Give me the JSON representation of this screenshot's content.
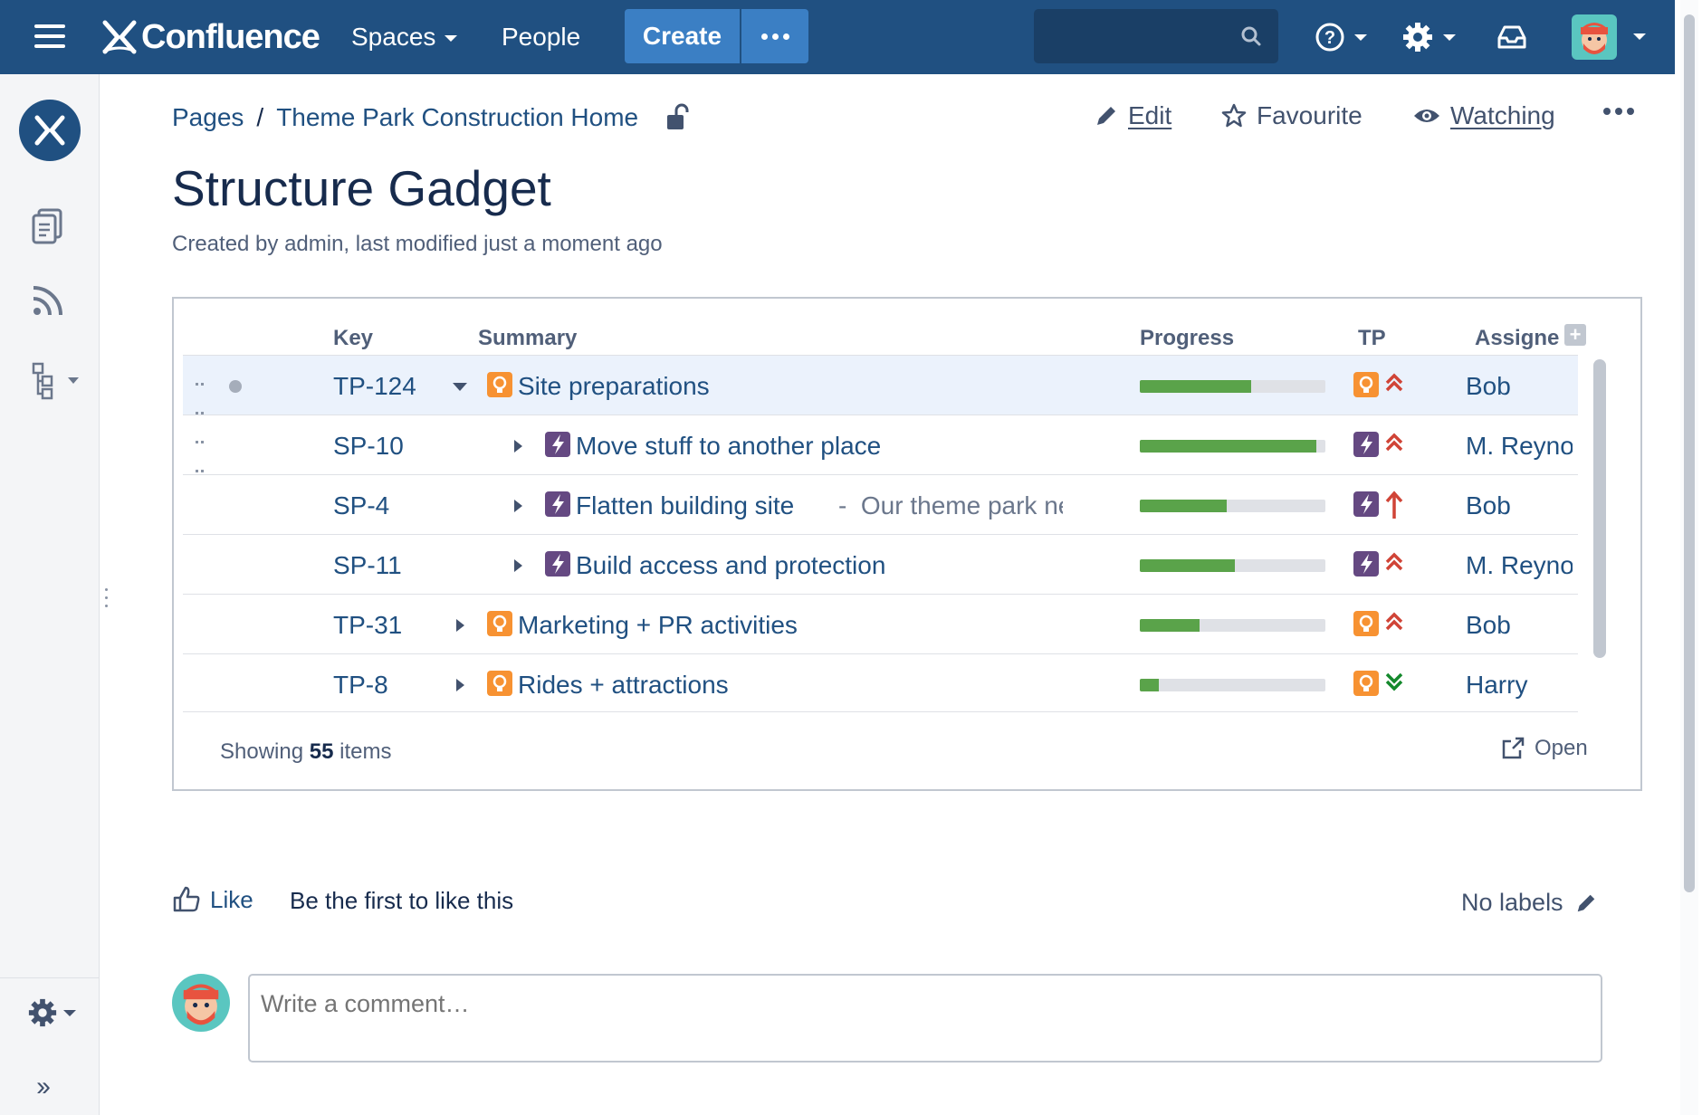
{
  "nav": {
    "brand": "Confluence",
    "spaces": "Spaces",
    "people": "People",
    "create": "Create",
    "search_placeholder": ""
  },
  "breadcrumb": {
    "pages": "Pages",
    "separator": "/",
    "home": "Theme Park Construction Home"
  },
  "actions": {
    "edit": "Edit",
    "favourite": "Favourite",
    "watching": "Watching"
  },
  "page": {
    "title": "Structure Gadget",
    "byline": "Created by admin, last modified just a moment ago"
  },
  "grid": {
    "columns": {
      "key": "Key",
      "summary": "Summary",
      "progress": "Progress",
      "tp": "TP",
      "assignee": "Assigne"
    },
    "rows": [
      {
        "key": "TP-124",
        "summary": "Site preparations",
        "desc": "",
        "progress": 0.6,
        "assignee": "Bob",
        "type": "idea",
        "priority": "high",
        "expanded": true,
        "level": 0
      },
      {
        "key": "SP-10",
        "summary": "Move stuff to another place",
        "desc": "",
        "progress": 0.95,
        "assignee": "M. Reynolds",
        "type": "epic",
        "priority": "high",
        "expanded": false,
        "level": 1
      },
      {
        "key": "SP-4",
        "summary": "Flatten building site",
        "desc": "Our theme park need",
        "progress": 0.47,
        "assignee": "Bob",
        "type": "epic",
        "priority": "highest",
        "expanded": false,
        "level": 1
      },
      {
        "key": "SP-11",
        "summary": "Build access and protection",
        "desc": "",
        "progress": 0.51,
        "assignee": "M. Reynolds",
        "type": "epic",
        "priority": "high",
        "expanded": false,
        "level": 1
      },
      {
        "key": "TP-31",
        "summary": "Marketing + PR activities",
        "desc": "",
        "progress": 0.32,
        "assignee": "Bob",
        "type": "idea",
        "priority": "high",
        "expanded": false,
        "level": 0
      },
      {
        "key": "TP-8",
        "summary": "Rides + attractions",
        "desc": "",
        "progress": 0.1,
        "assignee": "Harry",
        "type": "idea",
        "priority": "low",
        "expanded": false,
        "level": 0
      }
    ],
    "showing_prefix": "Showing",
    "showing_count": "55",
    "showing_suffix": "items",
    "open": "Open"
  },
  "footer": {
    "like": "Like",
    "like_text": "Be the first to like this",
    "labels": "No labels",
    "comment_placeholder": "Write a comment…"
  },
  "colors": {
    "nav_bg": "#205081",
    "link": "#205081",
    "progress": "#5aa34a",
    "idea": "#f79232",
    "epic": "#654982",
    "priority_high": "#d04437",
    "priority_low": "#14892c"
  },
  "icons": {
    "idea": "lightbulb-icon",
    "epic": "lightning-icon",
    "priority_high": "double-chevron-up-icon",
    "priority_highest": "arrow-up-icon",
    "priority_low": "double-chevron-down-icon"
  }
}
